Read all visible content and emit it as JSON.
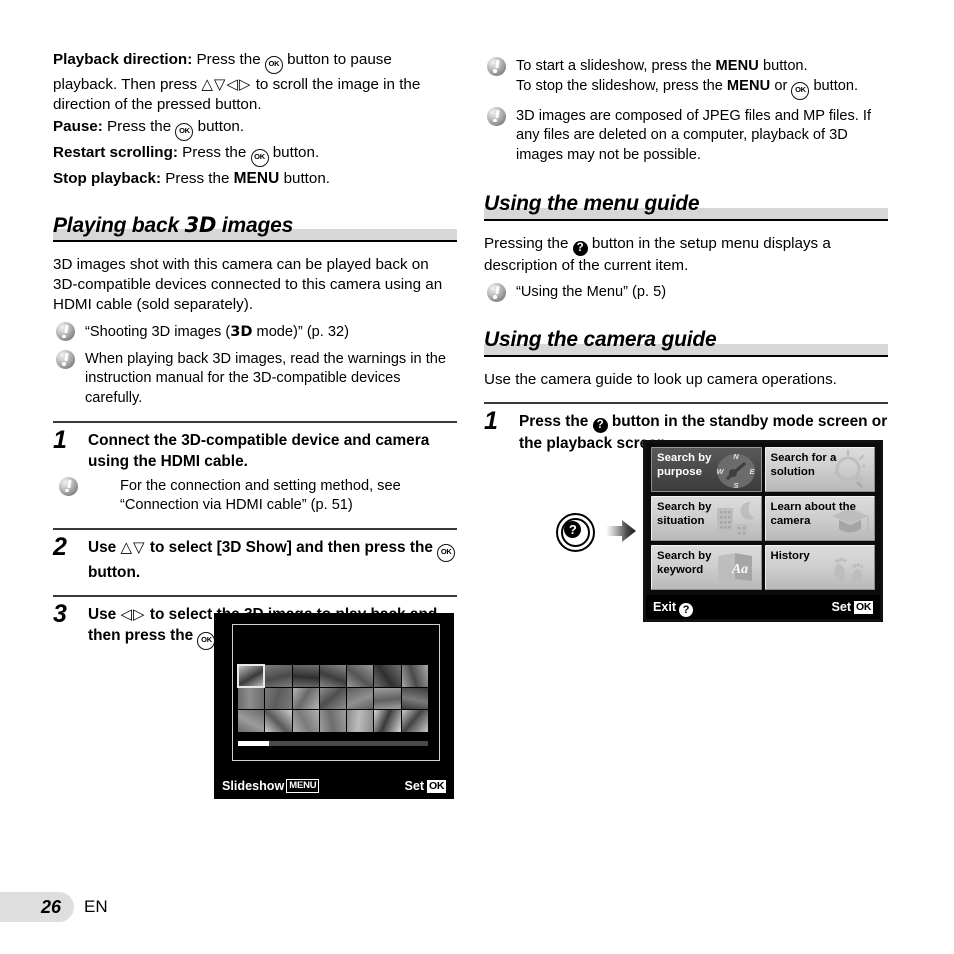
{
  "left_column": {
    "intro_lines": [
      {
        "label": "Playback direction:",
        "text_before_glyphs": " Press the ",
        "glyph1": "ok-button",
        "text_mid": " button to pause playback. Then press ",
        "glyph2": "arrows-up-down-left-right",
        "text_after": " to scroll the image in the direction of the pressed button."
      },
      {
        "label": "Pause:",
        "text_before_glyphs": " Press the ",
        "glyph1": "ok-button",
        "text_after": " button."
      },
      {
        "label": "Restart scrolling:",
        "text_before_glyphs": " Press the ",
        "glyph1": "ok-button",
        "text_after": " button."
      },
      {
        "label": "Stop playback:",
        "text_before_glyphs": " Press the ",
        "glyph1": "MENU",
        "text_after": " button."
      }
    ],
    "heading": "Playing back 3D images",
    "heading_part1": "Playing back ",
    "heading_3d": "3D",
    "heading_part2": " images",
    "body": "3D images shot with this camera can be played back on 3D-compatible devices connected to this camera using an HDMI cable (sold separately).",
    "notes": [
      {
        "pre": "“Shooting 3D images (",
        "glyph": "3D",
        "post": " mode)” (p. 32)"
      },
      {
        "text": "When playing back 3D images, read the warnings in the instruction manual for the 3D-compatible devices carefully."
      }
    ],
    "steps": [
      {
        "number": "1",
        "text": "Connect the 3D-compatible device and camera using the HDMI cable.",
        "note": "For the connection and setting method, see “Connection via HDMI cable” (p. 51)"
      },
      {
        "number": "2",
        "pre": "Use ",
        "glyph1": "arrows-up-down",
        "mid": " to select [3D Show] and then press the ",
        "glyph2": "ok-button",
        "post": " button."
      },
      {
        "number": "3",
        "pre": "Use ",
        "glyph1": "arrows-left-right",
        "mid": " to select the 3D image to play back and then press the ",
        "glyph2": "ok-button",
        "post": " button."
      }
    ],
    "lcd_thumbnails": {
      "bar_left_label": "Slideshow",
      "bar_left_badge": "MENU",
      "bar_right_label": "Set",
      "bar_right_badge": "OK",
      "grid_columns": 7,
      "grid_rows": 3,
      "selected_index": 0,
      "scrollbar_position": "left"
    }
  },
  "right_column": {
    "notes_top": [
      {
        "line1_pre": "To start a slideshow, press the ",
        "line1_glyph": "MENU",
        "line1_post": " button.",
        "line2_pre": "To stop the slideshow, press the ",
        "line2_glyph": "MENU",
        "line2_mid": " or ",
        "line2_glyph2": "ok-button",
        "line2_post": " button."
      },
      {
        "text": "3D images are composed of JPEG files and MP files. If any files are deleted on a computer, playback of 3D images may not be possible."
      }
    ],
    "heading_menu_guide": "Using the menu guide",
    "menu_guide_body_pre": "Pressing the ",
    "menu_guide_body_glyph": "question-button",
    "menu_guide_body_post": " button in the setup menu displays a description of the current item.",
    "menu_guide_note": "“Using the Menu” (p. 5)",
    "heading_camera_guide": "Using the camera guide",
    "camera_guide_body": "Use the camera guide to look up camera operations.",
    "camera_guide_step": {
      "number": "1",
      "pre": "Press the ",
      "glyph": "question-button",
      "post": " button in the standby mode screen or the playback screen."
    },
    "guide_screen": {
      "tiles": [
        {
          "label": "Search by purpose",
          "icon": "compass-icon",
          "selected": true
        },
        {
          "label": "Search for a solution",
          "icon": "lightbulb-icon",
          "selected": false
        },
        {
          "label": "Search by situation",
          "icon": "building-moon-icon",
          "selected": false
        },
        {
          "label": "Learn about the camera",
          "icon": "graduation-cap-icon",
          "selected": false
        },
        {
          "label": "Search by keyword",
          "icon": "book-aa-icon",
          "selected": false
        },
        {
          "label": "History",
          "icon": "footprints-icon",
          "selected": false
        }
      ],
      "bar_left_label": "Exit",
      "bar_left_badge": "question-button",
      "bar_right_label": "Set",
      "bar_right_badge": "OK",
      "compass_labels": {
        "north": "N",
        "east": "E",
        "south": "S",
        "west": "W"
      },
      "book_letters": "Aa"
    }
  },
  "footer": {
    "page_number": "26",
    "language": "EN"
  },
  "colors": {
    "heading_band": "#d7d7d7",
    "page_tab": "#dedede",
    "rule": "#3a3a3a",
    "lcd_background": "#000000",
    "tile_light": "#d0d0d0",
    "tile_selected": "#4b4b4b"
  }
}
